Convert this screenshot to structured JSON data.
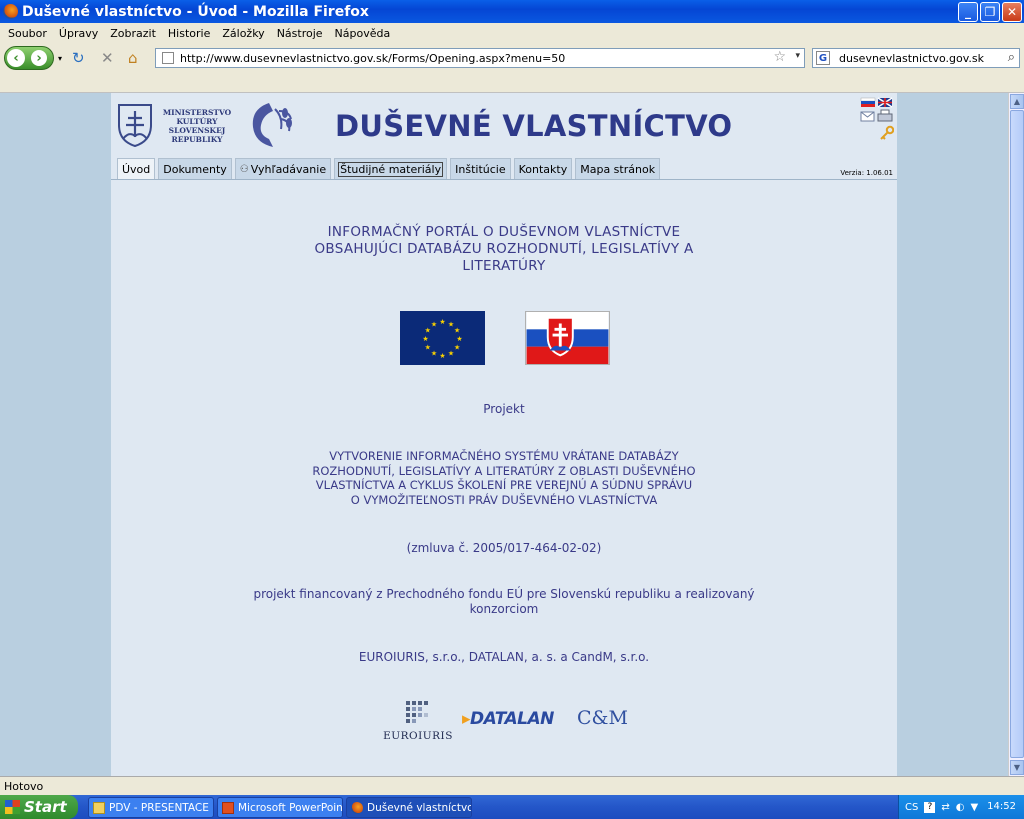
{
  "window": {
    "title": "Duševné vlastníctvo - Úvod - Mozilla Firefox"
  },
  "menu": [
    "Soubor",
    "Úpravy",
    "Zobrazit",
    "Historie",
    "Záložky",
    "Nástroje",
    "Nápověda"
  ],
  "nav": {
    "url": "http://www.dusevnevlastnictvo.gov.sk/Forms/Opening.aspx?menu=50",
    "search": "dusevnevlastnictvo.gov.sk"
  },
  "site": {
    "ministry": [
      "MINISTERSTVO",
      "KULTÚRY",
      "SLOVENSKEJ",
      "REPUBLIKY"
    ],
    "title": "DUŠEVNÉ VLASTNÍCTVO",
    "version": "Verzia: 1.06.01",
    "tabs": [
      "Úvod",
      "Dokumenty",
      "Vyhľadávanie",
      "Študijné materiály",
      "Inštitúcie",
      "Kontakty",
      "Mapa stránok"
    ],
    "portal": [
      "INFORMAČNÝ PORTÁL O DUŠEVNOM VLASTNÍCTVE",
      "OBSAHUJÚCI DATABÁZU ROZHODNUTÍ, LEGISLATÍVY A",
      "LITERATÚRY"
    ],
    "project_label": "Projekt",
    "project_name": [
      "VYTVORENIE INFORMAČNÉHO SYSTÉMU VRÁTANE DATABÁZY",
      "ROZHODNUTÍ, LEGISLATÍVY A LITERATÚRY Z OBLASTI DUŠEVNÉHO",
      "VLASTNÍCTVA A CYKLUS ŠKOLENÍ PRE VEREJNÚ A SÚDNU SPRÁVU",
      "O VYMOŽITEĽNOSTI PRÁV DUŠEVNÉHO VLASTNÍCTVA"
    ],
    "contract": "(zmluva č. 2005/017-464-02-02)",
    "financed": [
      "projekt financovaný z Prechodného fondu EÚ pre Slovenskú republiku a realizovaný",
      "konzorciom"
    ],
    "companies": "EUROIURIS, s.r.o., DATALAN, a. s. a CandM, s.r.o.",
    "partners": {
      "euroiuris": "EUROIURIS",
      "datalan": "DATALAN",
      "cm": "C&M"
    }
  },
  "status": "Hotovo",
  "taskbar": {
    "start": "Start",
    "tasks": [
      "PDV - PRESENTACE",
      "Microsoft PowerPoint ...",
      "Duševné vlastníctvo -..."
    ],
    "lang": "CS",
    "clock": "14:52"
  },
  "colors": {
    "site_title": "#2e3a8a",
    "text": "#3a3a88",
    "background": "#b9cfe0",
    "page": "#dfe8f2"
  }
}
